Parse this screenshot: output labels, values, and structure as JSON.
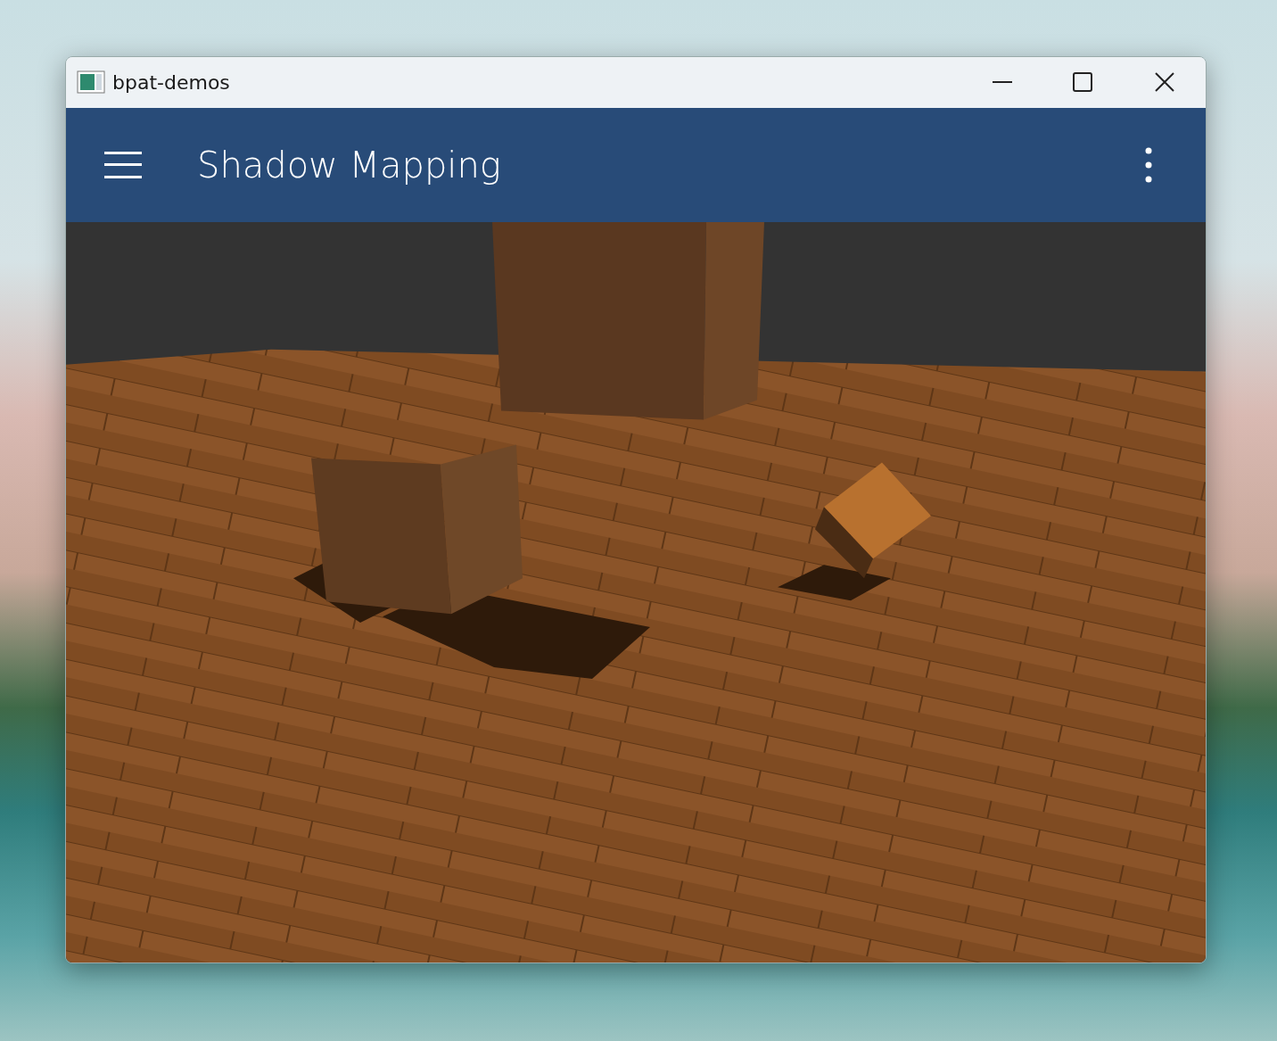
{
  "window": {
    "title": "bpat-demos"
  },
  "app_bar": {
    "title": "Shadow Mapping"
  }
}
